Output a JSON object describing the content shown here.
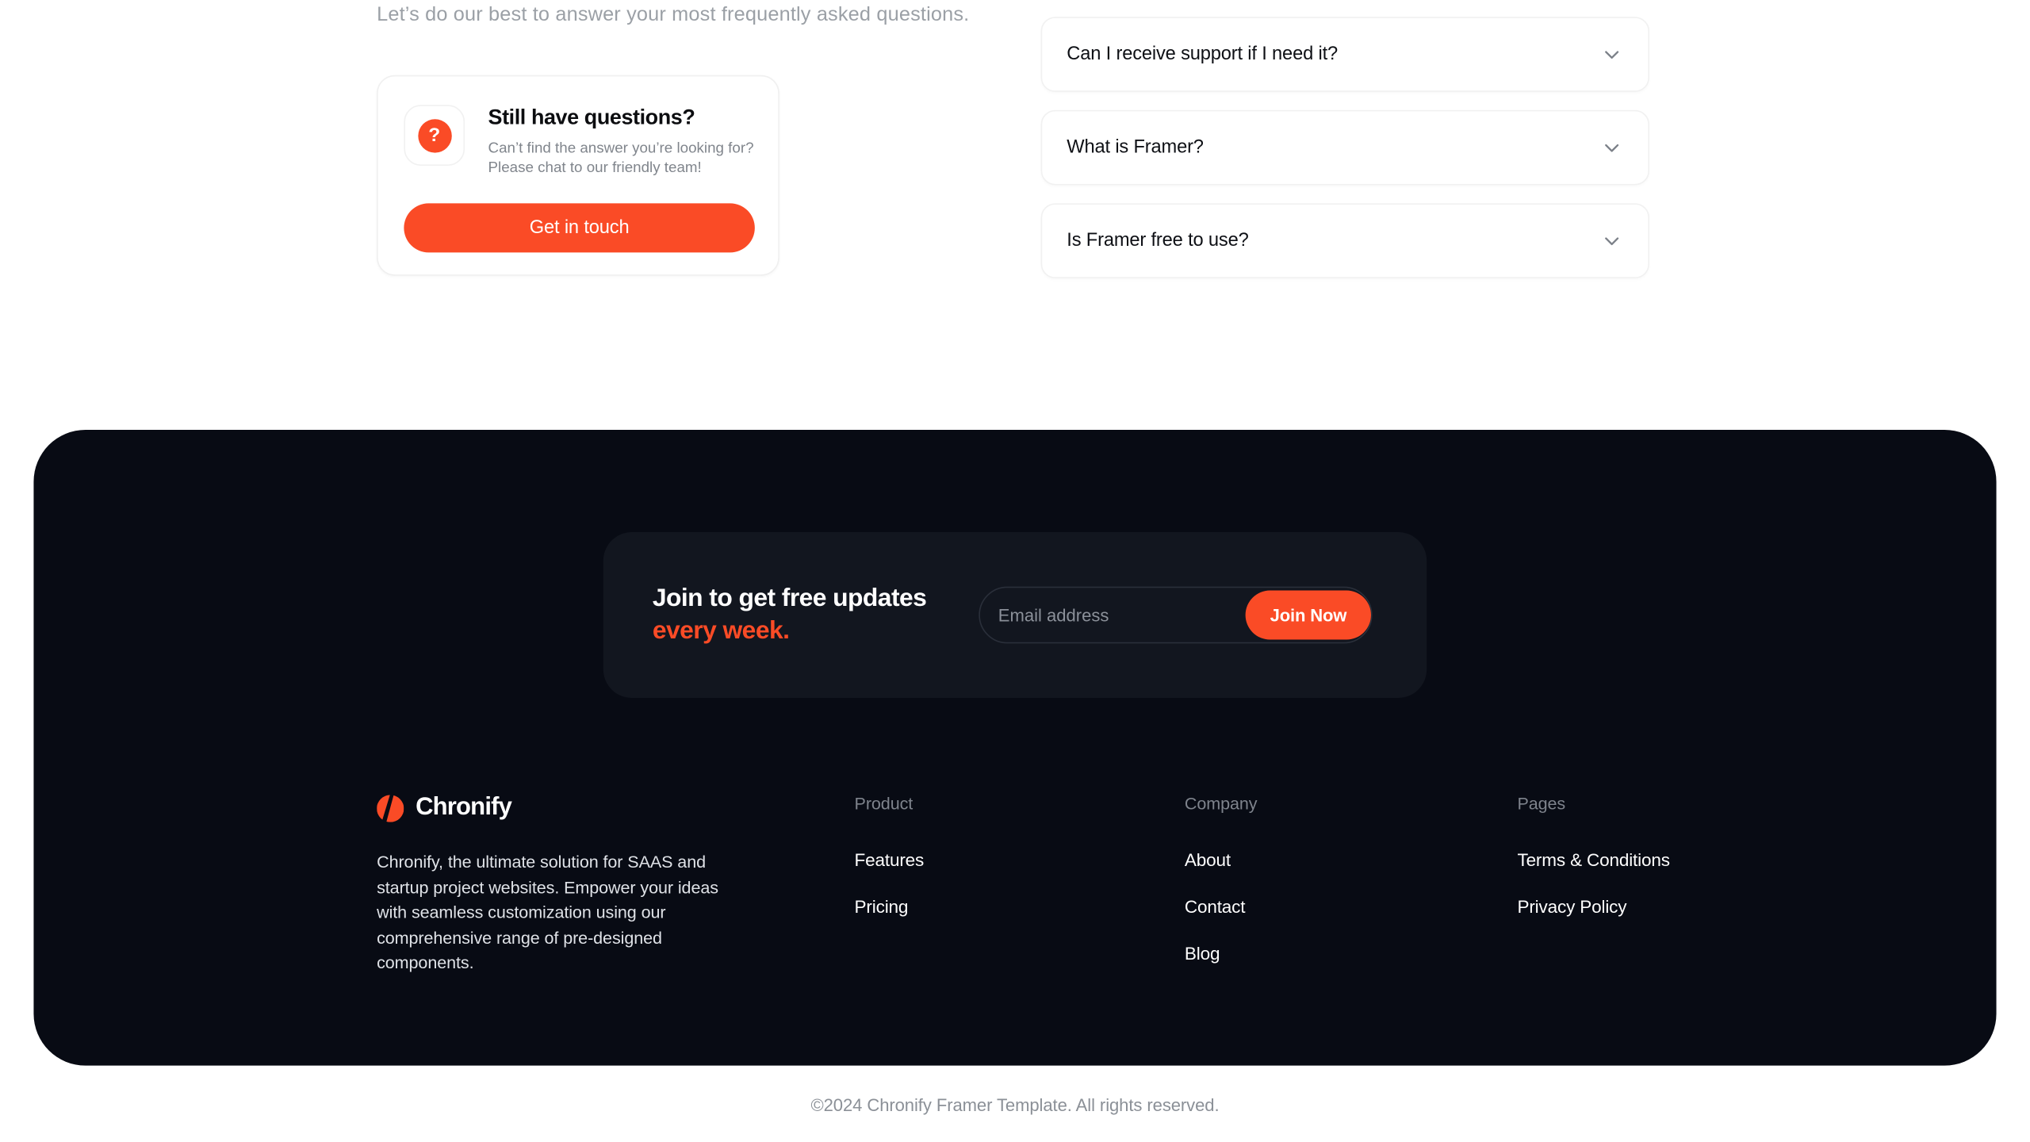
{
  "faq": {
    "intro": "Let’s do our best to answer your most frequently asked questions.",
    "support_card": {
      "icon": "question-mark-icon",
      "title": "Still have questions?",
      "subtitle_line1": "Can’t find the answer you’re looking for?",
      "subtitle_line2": "Please chat to our friendly team!",
      "cta_label": "Get in touch"
    },
    "items": [
      {
        "question": "Can I receive support if I need it?",
        "icon": "chevron-down-icon",
        "expanded": false
      },
      {
        "question": "What is Framer?",
        "icon": "chevron-down-icon",
        "expanded": false
      },
      {
        "question": "Is Framer free to use?",
        "icon": "chevron-down-icon",
        "expanded": false
      }
    ]
  },
  "newsletter": {
    "title_line1": "Join to get free updates",
    "title_line2": "every week.",
    "email_placeholder": "Email address",
    "email_value": "",
    "submit_label": "Join Now"
  },
  "footer": {
    "brand": {
      "logo_icon": "chronify-logo-icon",
      "name": "Chronify",
      "description": "Chronify, the ultimate solution for SAAS and startup project websites. Empower your ideas with seamless customization using our comprehensive range of pre-designed components."
    },
    "columns": [
      {
        "heading": "Product",
        "links": [
          "Features",
          "Pricing"
        ]
      },
      {
        "heading": "Company",
        "links": [
          "About",
          "Contact",
          "Blog"
        ]
      },
      {
        "heading": "Pages",
        "links": [
          "Terms & Conditions",
          "Privacy Policy"
        ]
      }
    ],
    "copyright": "©2024 Chronify Framer Template. All rights reserved."
  },
  "colors": {
    "accent": "#fa4b26",
    "footer_bg": "#080b14",
    "newsletter_bg": "#12161f",
    "page_bg": "#ffffff",
    "muted_text": "#8b9097"
  }
}
